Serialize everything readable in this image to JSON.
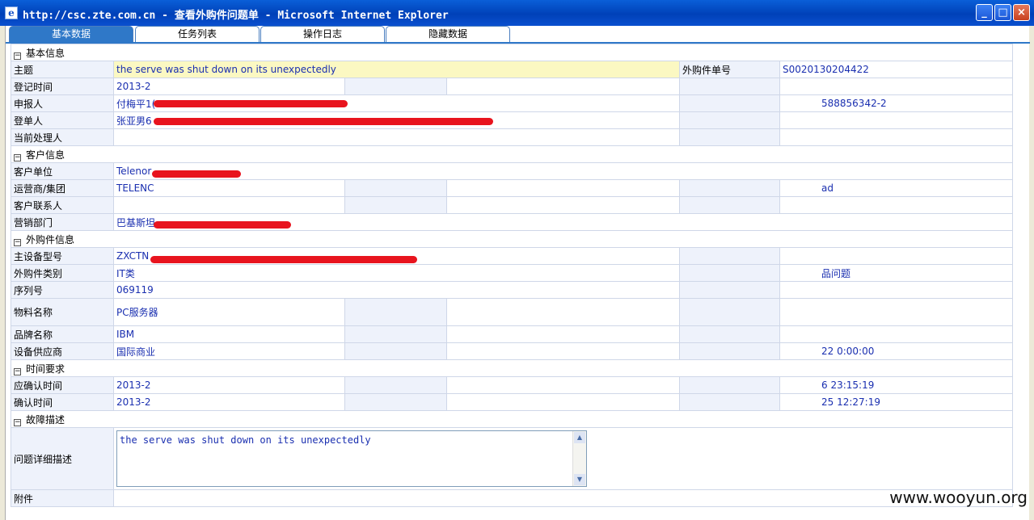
{
  "window": {
    "title": "http://csc.zte.com.cn - 查看外购件问题单 - Microsoft Internet Explorer",
    "min_glyph": "_",
    "max_glyph": "□",
    "close_glyph": "×"
  },
  "tabs": [
    {
      "label": "基本数据",
      "active": true
    },
    {
      "label": "任务列表",
      "active": false
    },
    {
      "label": "操作日志",
      "active": false
    },
    {
      "label": "隐藏数据",
      "active": false
    }
  ],
  "sections": {
    "basic": "基本信息",
    "customer": "客户信息",
    "part": "外购件信息",
    "time": "时间要求",
    "fault": "故障描述"
  },
  "fields": {
    "subject_label": "主题",
    "subject_value": "the serve was shut down on its unexpectedly",
    "order_no_label": "外购件单号",
    "order_no_value": "S0020130204422",
    "reg_time_label": "登记时间",
    "reg_time_value": "2013-2",
    "reporter_label": "申报人",
    "reporter_value": "付梅平1(",
    "reporter_phone_value": "588856342-2",
    "registrant_label": "登单人",
    "registrant_value": "张亚男6",
    "handler_label": "当前处理人",
    "customer_unit_label": "客户单位",
    "customer_unit_value": "Telenor",
    "operator_label": "运营商/集团",
    "operator_value": "TELENC",
    "operator_right_value": "ad",
    "customer_contact_label": "客户联系人",
    "sales_dept_label": "营销部门",
    "sales_dept_value": "巴基斯坦",
    "main_model_label": "主设备型号",
    "main_model_value": "ZXCTN",
    "part_type_label": "外购件类别",
    "part_type_value": "IT类",
    "part_type_right_value": "品问题",
    "serial_label": "序列号",
    "serial_value": "069119",
    "material_label": "物料名称",
    "material_value": "PC服务器",
    "brand_label": "品牌名称",
    "brand_value": "IBM",
    "supplier_label": "设备供应商",
    "supplier_value": "国际商业",
    "supplier_right_value": "22 0:00:00",
    "confirm_due_label": "应确认时间",
    "confirm_due_value": "2013-2",
    "confirm_due_right_value": "6 23:15:19",
    "confirmed_label": "确认时间",
    "confirmed_value": "2013-2",
    "confirmed_right_value": "25 12:27:19",
    "detail_label": "问题详细描述",
    "detail_value": "the serve was shut down on its unexpectedly",
    "attach_label": "附件"
  },
  "watermark": "www.wooyun.org",
  "colors": {
    "titlebar": "#0041b8",
    "active_tab": "#2f78c8",
    "label_bg": "#eef2fb",
    "value_text": "#1a2fb0",
    "subject_highlight": "#fbf8c2",
    "redaction": "#e8141e"
  }
}
